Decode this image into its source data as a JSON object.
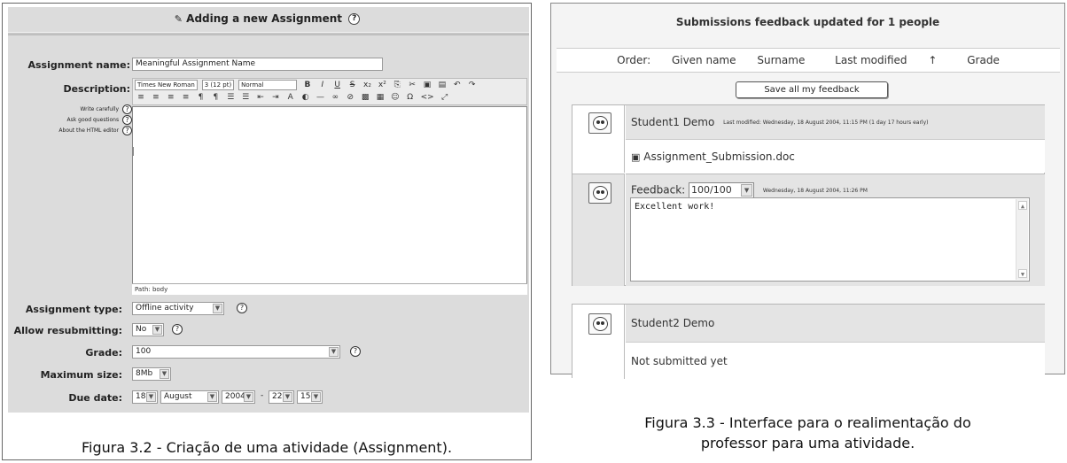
{
  "left": {
    "title": "Adding a new Assignment",
    "fields": {
      "name_label": "Assignment name:",
      "name_value": "Meaningful Assignment Name",
      "desc_label": "Description:",
      "help1": "Write carefully",
      "help2": "Ask good questions",
      "help3": "About the HTML editor",
      "font_name": "Times New Roman",
      "font_size": "3 (12 pt)",
      "font_style": "Normal",
      "path": "Path: body",
      "type_label": "Assignment type:",
      "type_value": "Offline activity",
      "resub_label": "Allow resubmitting:",
      "resub_value": "No",
      "grade_label": "Grade:",
      "grade_value": "100",
      "maxsize_label": "Maximum size:",
      "maxsize_value": "8Mb",
      "due_label": "Due date:",
      "due_day": "18",
      "due_month": "August",
      "due_year": "2004",
      "due_hour": "22",
      "due_min": "15",
      "due_sep": "-"
    },
    "caption": "Figura 3.2 - Criação de uma atividade  (Assignment)."
  },
  "right": {
    "title": "Submissions feedback updated for 1 people",
    "order_label": "Order:",
    "order": [
      "Given name",
      "Surname",
      "Last modified",
      "Grade"
    ],
    "save_label": "Save all my feedback",
    "student1": {
      "name": "Student1 Demo",
      "modified": "Last modified: Wednesday, 18 August 2004, 11:15 PM (1 day 17 hours early)",
      "file": "Assignment_Submission.doc",
      "feedback_label": "Feedback:",
      "grade": "100/100",
      "feedback_date": "Wednesday, 18 August 2004, 11:26 PM",
      "feedback_text": "Excellent work!"
    },
    "student2": {
      "name": "Student2 Demo",
      "status": "Not submitted yet"
    },
    "caption_line1": "Figura 3.3 - Interface para o realimentação  do",
    "caption_line2": "professor para uma atividade."
  }
}
